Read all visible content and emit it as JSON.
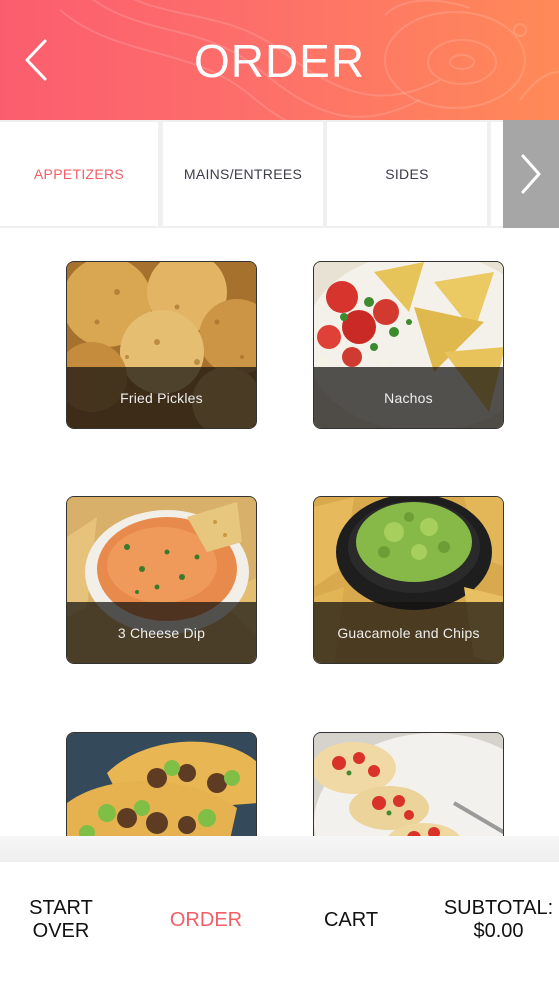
{
  "header": {
    "title": "ORDER"
  },
  "tabs": [
    {
      "label": "APPETIZERS",
      "active": true
    },
    {
      "label": "MAINS/ENTREES",
      "active": false
    },
    {
      "label": "SIDES",
      "active": false
    }
  ],
  "menu_items": [
    {
      "name": "Fried Pickles"
    },
    {
      "name": "Nachos"
    },
    {
      "name": "3 Cheese Dip"
    },
    {
      "name": "Guacamole and Chips"
    },
    {
      "name": "",
      "note": "tacos image (label scrolled out of view)"
    },
    {
      "name": "",
      "note": "bruschetta image (label scrolled out of view)"
    }
  ],
  "bottom_nav": {
    "start_over": "START OVER",
    "order": "ORDER",
    "cart": "CART",
    "subtotal_label": "SUBTOTAL:",
    "subtotal_value": "$0.00"
  },
  "colors": {
    "header_start": "#fb5d6f",
    "header_end": "#ff8a58",
    "accent": "#f25e68",
    "tab_scroll_bg": "#a6a6a6"
  },
  "icons": {
    "back": "chevron-left-icon",
    "tabs_next": "chevron-right-icon"
  }
}
